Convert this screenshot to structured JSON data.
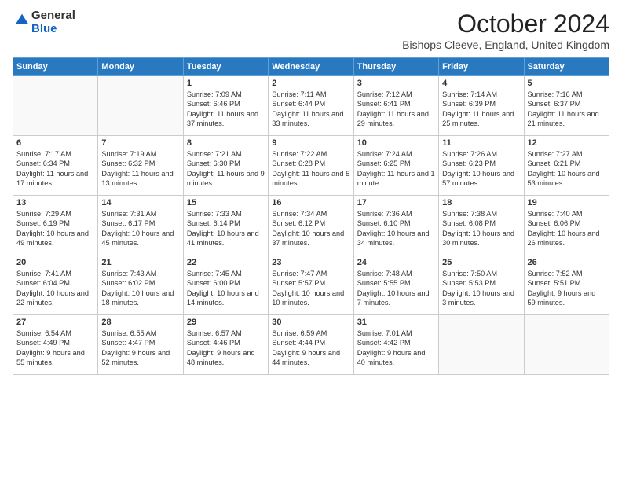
{
  "logo": {
    "line1": "General",
    "line2": "Blue"
  },
  "header": {
    "month_year": "October 2024",
    "location": "Bishops Cleeve, England, United Kingdom"
  },
  "days_of_week": [
    "Sunday",
    "Monday",
    "Tuesday",
    "Wednesday",
    "Thursday",
    "Friday",
    "Saturday"
  ],
  "weeks": [
    [
      {
        "day": "",
        "info": ""
      },
      {
        "day": "",
        "info": ""
      },
      {
        "day": "1",
        "info": "Sunrise: 7:09 AM\nSunset: 6:46 PM\nDaylight: 11 hours and 37 minutes."
      },
      {
        "day": "2",
        "info": "Sunrise: 7:11 AM\nSunset: 6:44 PM\nDaylight: 11 hours and 33 minutes."
      },
      {
        "day": "3",
        "info": "Sunrise: 7:12 AM\nSunset: 6:41 PM\nDaylight: 11 hours and 29 minutes."
      },
      {
        "day": "4",
        "info": "Sunrise: 7:14 AM\nSunset: 6:39 PM\nDaylight: 11 hours and 25 minutes."
      },
      {
        "day": "5",
        "info": "Sunrise: 7:16 AM\nSunset: 6:37 PM\nDaylight: 11 hours and 21 minutes."
      }
    ],
    [
      {
        "day": "6",
        "info": "Sunrise: 7:17 AM\nSunset: 6:34 PM\nDaylight: 11 hours and 17 minutes."
      },
      {
        "day": "7",
        "info": "Sunrise: 7:19 AM\nSunset: 6:32 PM\nDaylight: 11 hours and 13 minutes."
      },
      {
        "day": "8",
        "info": "Sunrise: 7:21 AM\nSunset: 6:30 PM\nDaylight: 11 hours and 9 minutes."
      },
      {
        "day": "9",
        "info": "Sunrise: 7:22 AM\nSunset: 6:28 PM\nDaylight: 11 hours and 5 minutes."
      },
      {
        "day": "10",
        "info": "Sunrise: 7:24 AM\nSunset: 6:25 PM\nDaylight: 11 hours and 1 minute."
      },
      {
        "day": "11",
        "info": "Sunrise: 7:26 AM\nSunset: 6:23 PM\nDaylight: 10 hours and 57 minutes."
      },
      {
        "day": "12",
        "info": "Sunrise: 7:27 AM\nSunset: 6:21 PM\nDaylight: 10 hours and 53 minutes."
      }
    ],
    [
      {
        "day": "13",
        "info": "Sunrise: 7:29 AM\nSunset: 6:19 PM\nDaylight: 10 hours and 49 minutes."
      },
      {
        "day": "14",
        "info": "Sunrise: 7:31 AM\nSunset: 6:17 PM\nDaylight: 10 hours and 45 minutes."
      },
      {
        "day": "15",
        "info": "Sunrise: 7:33 AM\nSunset: 6:14 PM\nDaylight: 10 hours and 41 minutes."
      },
      {
        "day": "16",
        "info": "Sunrise: 7:34 AM\nSunset: 6:12 PM\nDaylight: 10 hours and 37 minutes."
      },
      {
        "day": "17",
        "info": "Sunrise: 7:36 AM\nSunset: 6:10 PM\nDaylight: 10 hours and 34 minutes."
      },
      {
        "day": "18",
        "info": "Sunrise: 7:38 AM\nSunset: 6:08 PM\nDaylight: 10 hours and 30 minutes."
      },
      {
        "day": "19",
        "info": "Sunrise: 7:40 AM\nSunset: 6:06 PM\nDaylight: 10 hours and 26 minutes."
      }
    ],
    [
      {
        "day": "20",
        "info": "Sunrise: 7:41 AM\nSunset: 6:04 PM\nDaylight: 10 hours and 22 minutes."
      },
      {
        "day": "21",
        "info": "Sunrise: 7:43 AM\nSunset: 6:02 PM\nDaylight: 10 hours and 18 minutes."
      },
      {
        "day": "22",
        "info": "Sunrise: 7:45 AM\nSunset: 6:00 PM\nDaylight: 10 hours and 14 minutes."
      },
      {
        "day": "23",
        "info": "Sunrise: 7:47 AM\nSunset: 5:57 PM\nDaylight: 10 hours and 10 minutes."
      },
      {
        "day": "24",
        "info": "Sunrise: 7:48 AM\nSunset: 5:55 PM\nDaylight: 10 hours and 7 minutes."
      },
      {
        "day": "25",
        "info": "Sunrise: 7:50 AM\nSunset: 5:53 PM\nDaylight: 10 hours and 3 minutes."
      },
      {
        "day": "26",
        "info": "Sunrise: 7:52 AM\nSunset: 5:51 PM\nDaylight: 9 hours and 59 minutes."
      }
    ],
    [
      {
        "day": "27",
        "info": "Sunrise: 6:54 AM\nSunset: 4:49 PM\nDaylight: 9 hours and 55 minutes."
      },
      {
        "day": "28",
        "info": "Sunrise: 6:55 AM\nSunset: 4:47 PM\nDaylight: 9 hours and 52 minutes."
      },
      {
        "day": "29",
        "info": "Sunrise: 6:57 AM\nSunset: 4:46 PM\nDaylight: 9 hours and 48 minutes."
      },
      {
        "day": "30",
        "info": "Sunrise: 6:59 AM\nSunset: 4:44 PM\nDaylight: 9 hours and 44 minutes."
      },
      {
        "day": "31",
        "info": "Sunrise: 7:01 AM\nSunset: 4:42 PM\nDaylight: 9 hours and 40 minutes."
      },
      {
        "day": "",
        "info": ""
      },
      {
        "day": "",
        "info": ""
      }
    ]
  ]
}
